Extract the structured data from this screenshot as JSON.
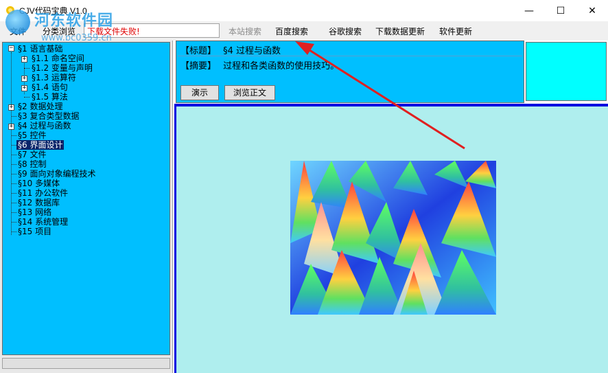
{
  "window": {
    "title": "CJV代码宝典 V1.0",
    "minimize_glyph": "—",
    "maximize_glyph": "☐",
    "close_glyph": "✕"
  },
  "watermark": {
    "text": "河东软件园",
    "url": "www.pc0359.cn"
  },
  "menu": {
    "file": "文件",
    "classify": "分类浏览",
    "status_text": "下载文件失败!"
  },
  "toolbar": {
    "site_search": "本站搜索",
    "baidu_search": "百度搜索",
    "google_search": "谷歌搜索",
    "update_data": "下载数据更新",
    "update_software": "软件更新"
  },
  "tree": {
    "items": [
      {
        "label": "§1 语言基础",
        "expander": "−"
      },
      {
        "label": "§1.1 命名空间",
        "expander": "+"
      },
      {
        "label": "§1.2 变量与声明",
        "expander": ""
      },
      {
        "label": "§1.3 运算符",
        "expander": "+"
      },
      {
        "label": "§1.4 语句",
        "expander": "+"
      },
      {
        "label": "§1.5 算法",
        "expander": ""
      },
      {
        "label": "§2 数据处理",
        "expander": "+"
      },
      {
        "label": "§3 复合类型数据",
        "expander": ""
      },
      {
        "label": "§4 过程与函数",
        "expander": "+"
      },
      {
        "label": "§5 控件",
        "expander": ""
      },
      {
        "label": "§6 界面设计",
        "expander": "",
        "selected": true
      },
      {
        "label": "§7 文件",
        "expander": ""
      },
      {
        "label": "§8 控制",
        "expander": ""
      },
      {
        "label": "§9 面向对象编程技术",
        "expander": ""
      },
      {
        "label": "§10 多媒体",
        "expander": ""
      },
      {
        "label": "§11 办公软件",
        "expander": ""
      },
      {
        "label": "§12 数据库",
        "expander": ""
      },
      {
        "label": "§13 网络",
        "expander": ""
      },
      {
        "label": "§14 系统管理",
        "expander": ""
      },
      {
        "label": "§15 项目",
        "expander": ""
      }
    ]
  },
  "info": {
    "title_label": "【标题】",
    "title_value": "§4 过程与函数",
    "abstract_label": "【摘要】",
    "abstract_value": "过程和各类函数的使用技巧。",
    "demo_button": "演示",
    "browse_button": "浏览正文"
  },
  "colors": {
    "tree_bg": "#00bfff",
    "content_bg": "#afeeee",
    "cyan_box": "#00ffff",
    "divider": "#0000e0",
    "status_text": "#e00000",
    "arrow": "#e02020"
  }
}
